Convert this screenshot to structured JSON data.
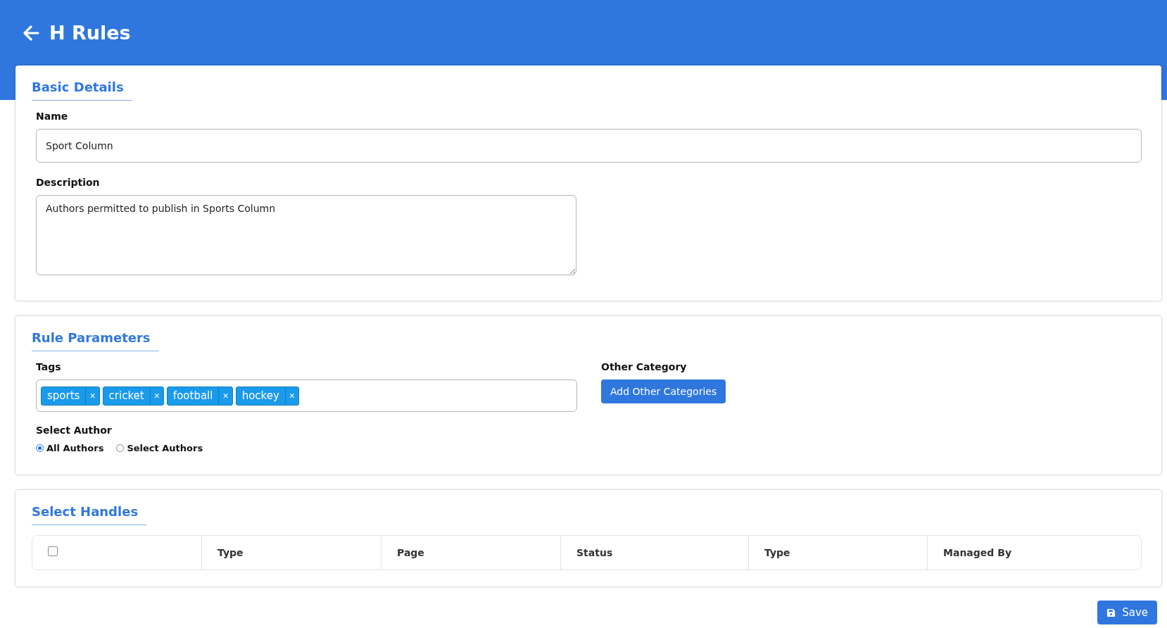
{
  "header": {
    "title": "H Rules"
  },
  "basic_details": {
    "title": "Basic Details",
    "name": {
      "label": "Name",
      "value": "Sport Column"
    },
    "description": {
      "label": "Description",
      "value": "Authors permitted to publish in Sports Column"
    }
  },
  "rule_parameters": {
    "title": "Rule Parameters",
    "tags": {
      "label": "Tags",
      "items": [
        {
          "label": "sports",
          "remove": "×"
        },
        {
          "label": "cricket",
          "remove": "×"
        },
        {
          "label": "football",
          "remove": "×"
        },
        {
          "label": "hockey",
          "remove": "×"
        }
      ]
    },
    "other_category": {
      "label": "Other Category",
      "button": "Add Other Categories"
    },
    "select_author": {
      "label": "Select Author",
      "options": [
        {
          "label": "All Authors",
          "selected": true
        },
        {
          "label": "Select Authors",
          "selected": false
        }
      ]
    }
  },
  "select_handles": {
    "title": "Select Handles",
    "table": {
      "select_all_checked": false,
      "columns": [
        "Type",
        "Page",
        "Status",
        "Type",
        "Managed By"
      ]
    }
  },
  "save_button": "Save"
}
